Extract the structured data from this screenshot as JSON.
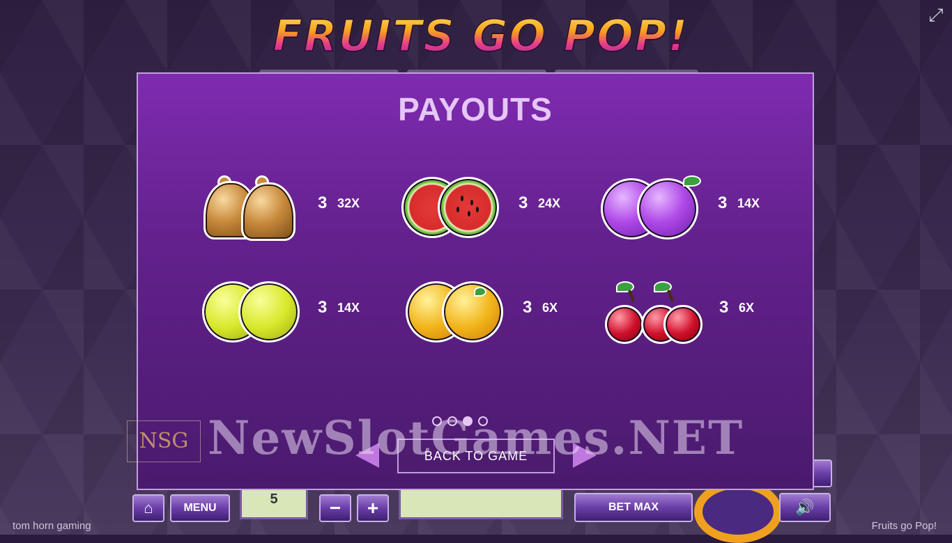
{
  "game": {
    "logo_text": "FRUITS GO POP!",
    "expand_icon": "expand-icon"
  },
  "payouts": {
    "title": "PAYOUTS",
    "items": [
      {
        "symbol": "bell",
        "count": "3",
        "multiplier": "32X"
      },
      {
        "symbol": "watermelon",
        "count": "3",
        "multiplier": "24X"
      },
      {
        "symbol": "plum",
        "count": "3",
        "multiplier": "14X"
      },
      {
        "symbol": "lemon",
        "count": "3",
        "multiplier": "14X"
      },
      {
        "symbol": "orange",
        "count": "3",
        "multiplier": "6X"
      },
      {
        "symbol": "cherry",
        "count": "3",
        "multiplier": "6X"
      }
    ],
    "pages": 4,
    "active_page": 2,
    "back_label": "BACK TO GAME"
  },
  "watermark": {
    "logo_text": "NSG",
    "text": "NewSlotGames.NET"
  },
  "controls": {
    "menu_label": "MENU",
    "lines_value": "5",
    "bet_max_label": "BET MAX",
    "minus_label": "−",
    "plus_label": "+"
  },
  "footer": {
    "provider": "tom horn gaming",
    "game_name": "Fruits go Pop!"
  },
  "colors": {
    "panel": "#63218d",
    "panel_border": "#c59ee0",
    "title": "#e5c7f6",
    "accent": "#c078e0"
  }
}
